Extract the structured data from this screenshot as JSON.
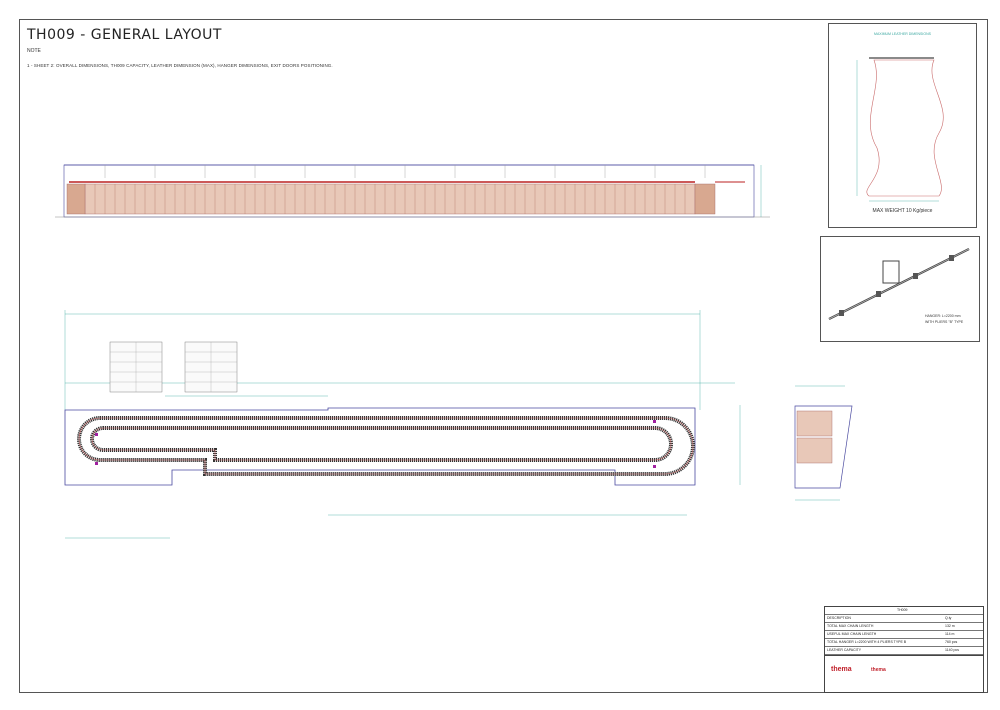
{
  "drawing": {
    "title": "TH009 - GENERAL LAYOUT",
    "note_label": "NOTE",
    "note_text": "1 - SHEET 2: OVERALL DIMENSIONS, TH009 CAPACITY, LEATHER DIMENSION (MAX), HANGER DIMENSIONS, EXIT DOORS POSITIONING."
  },
  "leather_panel": {
    "header": "MAXIMUM LEATHER DIMENSIONS",
    "max_weight": "MAX WEIGHT 10 Kg/piece"
  },
  "hanger_panel": {
    "caption_line1": "HANGER: L=2200 mm",
    "caption_line2": "WITH PLIERS \"B\" TYPE"
  },
  "title_block": {
    "header": "TH009",
    "rows": [
      {
        "label": "DESCRIPTION",
        "value": "Q.ty"
      },
      {
        "label": "TOTAL MAX CHAIN LENGTH",
        "value": "132 m"
      },
      {
        "label": "USEFUL MAX CHAIN LENGTH",
        "value": "114 m"
      },
      {
        "label": "TOTAL HANGER L=2200 WITH 4 PLIERS TYPE B",
        "value": "760 pcs"
      },
      {
        "label": "LEATHER CAPACITY",
        "value": "1140 pcs"
      }
    ],
    "brand": "thema",
    "brand2": "thema"
  }
}
